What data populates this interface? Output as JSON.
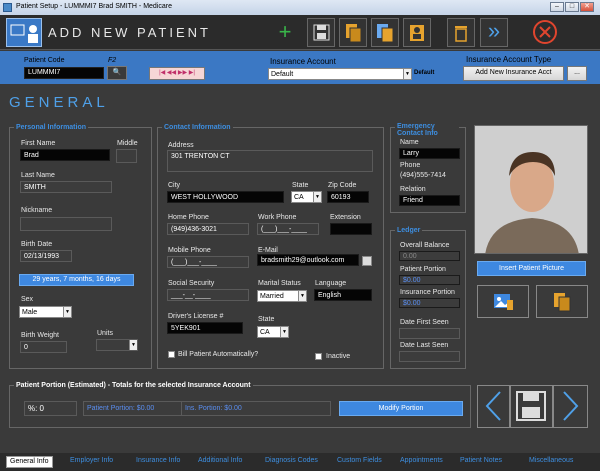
{
  "window": {
    "title": "Patient Setup - LUMMMI7  Brad SMITH - Medicare",
    "min": "–",
    "max": "□",
    "close": "✕"
  },
  "header": {
    "title": "ADD NEW PATIENT"
  },
  "toolbar": {
    "add_icon": "+",
    "save_icon": "💾",
    "copy_icon": "❐",
    "copy2_icon": "❏",
    "user_icon": "👤",
    "delete_icon": "🗑",
    "forward_icon": "»",
    "cancel_icon": "✕"
  },
  "patient_bar": {
    "code_label": "Patient Code",
    "f2": "F2",
    "code_value": "LUMMMI7",
    "search_icon": "🔍",
    "nav_icons": "|◀ ◀◀ ▶▶ ▶|",
    "insurance_label": "Insurance Account",
    "insurance_value": "Default",
    "default_tag": "Default",
    "type_label": "Insurance Account Type",
    "add_ins_label": "Add New Insurance Acct",
    "more_label": "..."
  },
  "section_title": "GENERAL",
  "personal": {
    "title": "Personal Information",
    "first_label": "First Name",
    "first_value": "Brad",
    "middle_label": "Middle",
    "last_label": "Last Name",
    "last_value": "SMITH",
    "nick_label": "Nickname",
    "birth_label": "Birth Date",
    "birth_value": "02/13/1993",
    "age_text": "29 years, 7 months, 16 days",
    "sex_label": "Sex",
    "sex_value": "Male",
    "weight_label": "Birth Weight",
    "weight_value": "0",
    "units_label": "Units"
  },
  "contact": {
    "title": "Contact Information",
    "address_label": "Address",
    "address_value": "301 TRENTON CT",
    "city_label": "City",
    "city_value": "WEST HOLLYWOOD",
    "state_label": "State",
    "state_value": "CA",
    "zip_label": "Zip Code",
    "zip_value": "60193",
    "home_label": "Home Phone",
    "home_value": "(949)436-3021",
    "work_label": "Work Phone",
    "work_value": "(___)___-____",
    "ext_label": "Extension",
    "mobile_label": "Mobile Phone",
    "mobile_value": "(___)___-____",
    "email_label": "E-Mail",
    "email_value": "bradsmith29@outlook.com",
    "ssn_label": "Social Security",
    "ssn_value": "___-__-____",
    "marital_label": "Marital Status",
    "marital_value": "Married",
    "lang_label": "Language",
    "lang_value": "English",
    "dl_label": "Driver's License #",
    "dl_value": "5YEK901",
    "dl_state_label": "State",
    "dl_state_value": "CA",
    "bill_label": "Bill Patient Automatically?",
    "inactive_label": "Inactive"
  },
  "emergency": {
    "title": "Emergency Contact Info",
    "name_label": "Name",
    "name_value": "Larry",
    "phone_label": "Phone",
    "phone_value": "(494)555-7414",
    "relation_label": "Relation",
    "relation_value": "Friend"
  },
  "ledger": {
    "title": "Ledger",
    "overall_label": "Overall Balance",
    "overall_value": "0.00",
    "patient_label": "Patient Portion",
    "patient_value": "$0.00",
    "ins_label": "Insurance Portion",
    "ins_value": "$0.00",
    "first_seen_label": "Date First Seen",
    "last_seen_label": "Date Last Seen"
  },
  "photo": {
    "insert_label": "Insert Patient Picture"
  },
  "portion": {
    "title": "Patient Portion (Estimated) - Totals for the selected Insurance Account",
    "pct": "%: 0",
    "patient": "Patient Portion: $0.00",
    "ins": "Ins. Portion: $0.00",
    "modify": "Modify Portion"
  },
  "nav": {
    "prev": "‹",
    "next": "›"
  },
  "tabs": [
    "General Info",
    "Employer Info",
    "Insurance Info",
    "Additional Info",
    "Diagnosis Codes",
    "Custom Fields",
    "Appointments",
    "Patient Notes",
    "Miscellaneous"
  ],
  "colors": {
    "accent": "#3b78c4",
    "section": "#4fa0e8",
    "toolbar_orange": "#e6a32e",
    "toolbar_green": "#39b54a",
    "toolbar_red": "#e0452e"
  }
}
